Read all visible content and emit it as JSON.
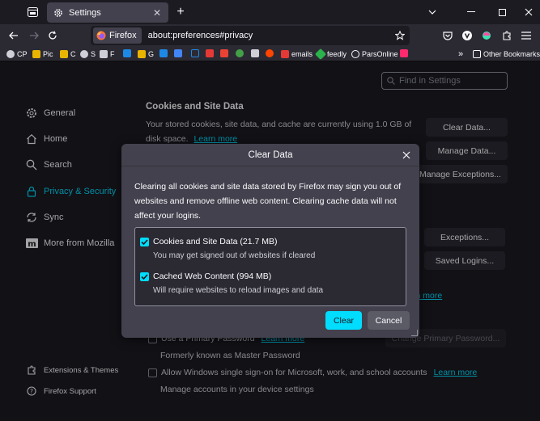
{
  "colors": {
    "accent": "#00ddff",
    "bg": "#1c1b22",
    "toolbar": "#2b2a33",
    "dialog": "#42414d"
  },
  "tab": {
    "title": "Settings"
  },
  "urlbar": {
    "identity": "Firefox",
    "url": "about:preferences#privacy"
  },
  "bookmarks": [
    "CP",
    "Pic",
    "C",
    "S",
    "F",
    "G",
    "emails",
    "feedly",
    "ParsOnline"
  ],
  "bookmarks_other": "Other Bookmarks",
  "search": {
    "placeholder": "Find in Settings"
  },
  "categories": {
    "general": "General",
    "home": "Home",
    "search": "Search",
    "privacy": "Privacy & Security",
    "sync": "Sync",
    "mozilla": "More from Mozilla",
    "extensions": "Extensions & Themes",
    "support": "Firefox Support"
  },
  "cookies": {
    "title": "Cookies and Site Data",
    "desc_line1": "Your stored cookies, site data, and cache are currently using 1.0 GB of",
    "desc_line2": "disk space.",
    "learn_more": "Learn more",
    "clear_data": "Clear Data...",
    "manage_data": "Manage Data...",
    "manage_exceptions": "Manage Exceptions..."
  },
  "logins": {
    "exceptions": "Exceptions...",
    "saved_logins": "Saved Logins...",
    "learn_more_fragment": "rn more",
    "primary_password": "Use a Primary Password",
    "primary_learn_more": "Learn more",
    "change_primary": "Change Primary Password...",
    "formerly": "Formerly known as Master Password",
    "sso": "Allow Windows single sign-on for Microsoft, work, and school accounts",
    "sso_learn_more": "Learn more",
    "manage_accounts": "Manage accounts in your device settings"
  },
  "dialog": {
    "title": "Clear Data",
    "desc_line1": "Clearing all cookies and site data stored by Firefox may sign you out of",
    "desc_line2": "websites and remove offline web content. Clearing cache data will not",
    "desc_line3": "affect your logins.",
    "opt1_label": "Cookies and Site Data (21.7 MB)",
    "opt1_sub": "You may get signed out of websites if cleared",
    "opt2_label": "Cached Web Content (994 MB)",
    "opt2_sub": "Will require websites to reload images and data",
    "clear": "Clear",
    "cancel": "Cancel"
  }
}
